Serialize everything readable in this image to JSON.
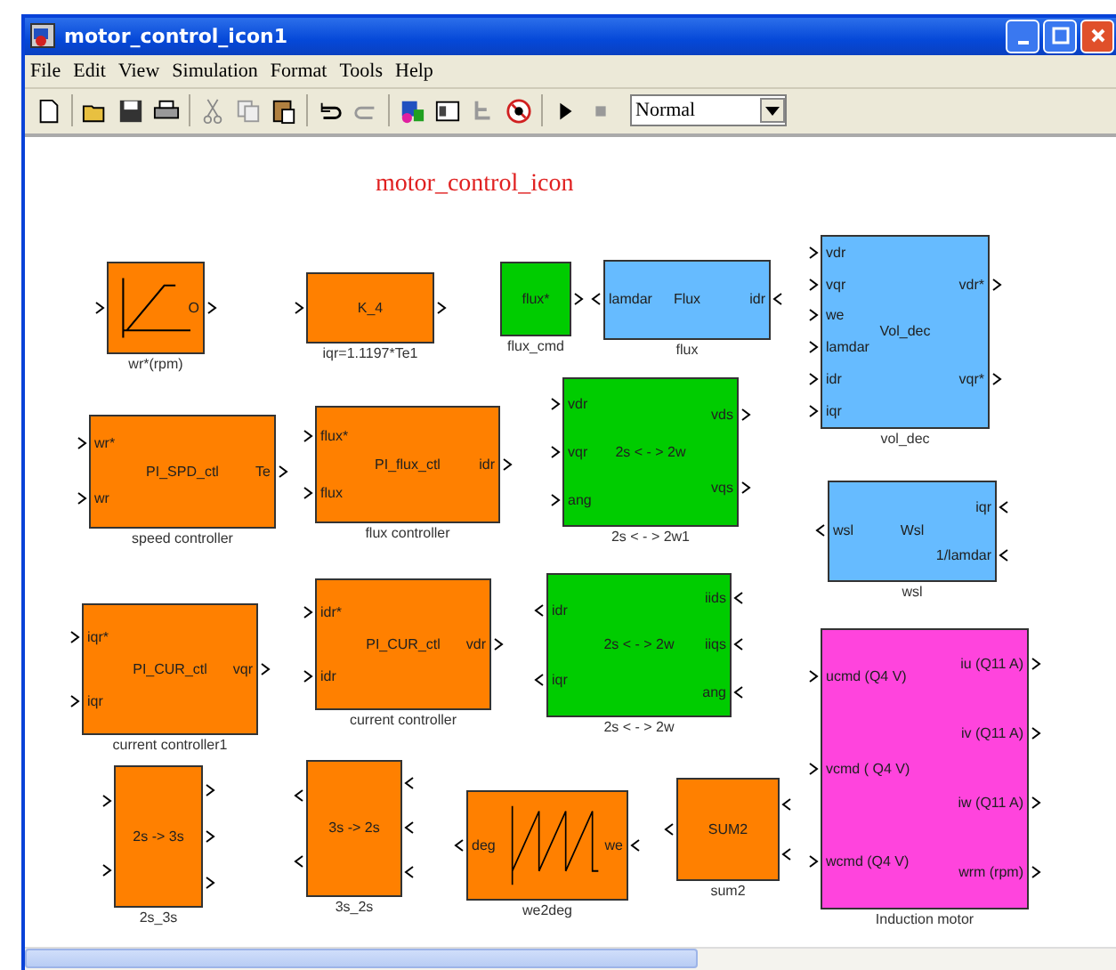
{
  "window": {
    "title": "motor_control_icon1"
  },
  "menu": [
    "File",
    "Edit",
    "View",
    "Simulation",
    "Format",
    "Tools",
    "Help"
  ],
  "toolbar": {
    "mode": "Normal"
  },
  "diagram": {
    "title": "motor_control_icon",
    "blocks": [
      {
        "kind": "ramp",
        "color": "#ff8000",
        "flipped": false,
        "caption": "wr*(rpm)",
        "outputs": [
          "O"
        ]
      },
      {
        "kind": "plain",
        "color": "#ff8000",
        "flipped": false,
        "text": "K_4",
        "caption": "iqr=1.1197*Te1"
      },
      {
        "kind": "plain",
        "color": "#00cc00",
        "flipped": false,
        "text": "flux*",
        "caption": "flux_cmd"
      },
      {
        "kind": "plain",
        "color": "#66bbff",
        "flipped": true,
        "text": "Flux",
        "caption": "flux",
        "inputs": [
          "lamdar"
        ],
        "outputs": [
          "idr"
        ]
      },
      {
        "kind": "plain",
        "color": "#66bbff",
        "flipped": false,
        "text": "Vol_dec",
        "caption": "vol_dec",
        "inputs": [
          "vdr",
          "vqr",
          "we",
          "lamdar",
          "idr",
          "iqr"
        ],
        "outputs": [
          "vdr*",
          "vqr*"
        ]
      },
      {
        "kind": "plain",
        "color": "#ff8000",
        "flipped": false,
        "text": "PI_SPD_ctl",
        "caption": "speed controller",
        "inputs": [
          "wr*",
          "wr"
        ],
        "outputs": [
          "Te"
        ]
      },
      {
        "kind": "plain",
        "color": "#ff8000",
        "flipped": false,
        "text": "PI_flux_ctl",
        "caption": "flux controller",
        "inputs": [
          "flux*",
          "flux"
        ],
        "outputs": [
          "idr"
        ]
      },
      {
        "kind": "plain",
        "color": "#00cc00",
        "flipped": false,
        "text": "2s < - > 2w",
        "caption": "2s < - > 2w1",
        "inputs": [
          "vdr",
          "vqr",
          "ang"
        ],
        "outputs": [
          "vds",
          "vqs"
        ]
      },
      {
        "kind": "plain",
        "color": "#66bbff",
        "flipped": true,
        "text": "Wsl",
        "caption": "wsl",
        "inputs": [
          "wsl"
        ],
        "outputs": [
          "iqr",
          "1/lamdar"
        ]
      },
      {
        "kind": "plain",
        "color": "#ff8000",
        "flipped": false,
        "text": "PI_CUR_ctl",
        "caption": "current controller1",
        "inputs": [
          "iqr*",
          "iqr"
        ],
        "outputs": [
          "vqr"
        ]
      },
      {
        "kind": "plain",
        "color": "#ff8000",
        "flipped": false,
        "text": "PI_CUR_ctl",
        "caption": "current controller",
        "inputs": [
          "idr*",
          "idr"
        ],
        "outputs": [
          "vdr"
        ]
      },
      {
        "kind": "plain",
        "color": "#00cc00",
        "flipped": true,
        "text": "2s < - > 2w",
        "caption": "2s < - > 2w",
        "inputs": [
          "idr",
          "iqr"
        ],
        "outputs": [
          "iids",
          "iiqs",
          "ang"
        ]
      },
      {
        "kind": "plain",
        "color": "#ff8000",
        "flipped": false,
        "text": "2s -> 3s",
        "caption": "2s_3s"
      },
      {
        "kind": "plain",
        "color": "#ff8000",
        "flipped": true,
        "text": "3s -> 2s",
        "caption": "3s_2s"
      },
      {
        "kind": "sawtooth",
        "color": "#ff8000",
        "flipped": true,
        "caption": "we2deg",
        "inputs": [
          "deg"
        ],
        "outputs": [
          "we"
        ]
      },
      {
        "kind": "plain",
        "color": "#ff8000",
        "flipped": true,
        "text": "SUM2",
        "caption": "sum2"
      },
      {
        "kind": "plain",
        "color": "#ff44dd",
        "flipped": false,
        "caption": "Induction motor",
        "inputs": [
          "ucmd (Q4 V)",
          "vcmd ( Q4 V)",
          "wcmd (Q4 V)"
        ],
        "outputs": [
          "iu (Q11 A)",
          "iv (Q11 A)",
          "iw (Q11 A)",
          "wrm (rpm)"
        ]
      }
    ]
  }
}
